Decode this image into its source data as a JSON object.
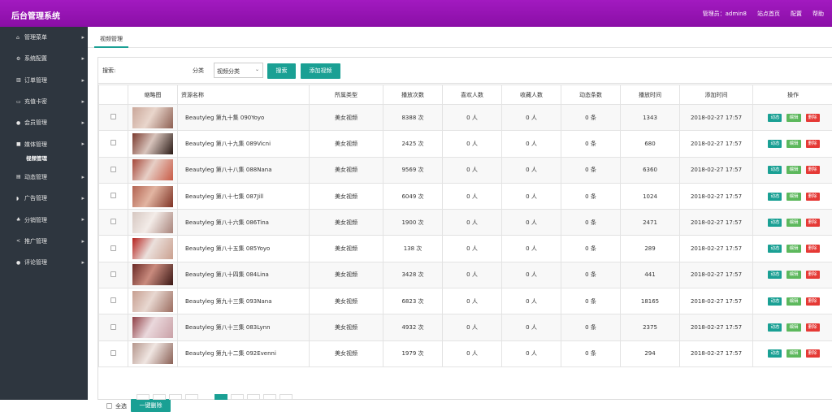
{
  "header": {
    "title": "后台管理系统",
    "admin_label": "管理员：admin8",
    "home_link": "站点首页",
    "config_link": "配置",
    "help_link": "帮助"
  },
  "sidebar": {
    "items": [
      {
        "label": "管理菜单",
        "icon": "home-icon",
        "glyph": "⌂"
      },
      {
        "label": "系统配置",
        "icon": "gears-icon",
        "glyph": "⚙"
      },
      {
        "label": "订单管理",
        "icon": "chart-icon",
        "glyph": "▥"
      },
      {
        "label": "充值卡密",
        "icon": "card-icon",
        "glyph": "▭"
      },
      {
        "label": "会员管理",
        "icon": "user-icon",
        "glyph": "●"
      },
      {
        "label": "媒体管理",
        "icon": "video-icon",
        "glyph": "■"
      },
      {
        "label": "动态管理",
        "icon": "folder-icon",
        "glyph": "▤"
      },
      {
        "label": "广告管理",
        "icon": "rss-icon",
        "glyph": "◗"
      },
      {
        "label": "分销管理",
        "icon": "sitemap-icon",
        "glyph": "♣"
      },
      {
        "label": "推广管理",
        "icon": "share-icon",
        "glyph": "<"
      },
      {
        "label": "评论管理",
        "icon": "comment-icon",
        "glyph": "●"
      }
    ],
    "sub_active": "视频管理",
    "arrow": "▸"
  },
  "tab": {
    "label": "视频管理"
  },
  "search": {
    "keyword_label": "搜索:",
    "keyword_value": "",
    "category_label": "分类",
    "category_value": "视频分类",
    "search_button": "搜索",
    "add_button": "添加视频"
  },
  "table": {
    "headers": [
      "",
      "缩略图",
      "资源名称",
      "所属类型",
      "播放次数",
      "喜欢人数",
      "收藏人数",
      "动态条数",
      "播放时间",
      "添加时间",
      "操作"
    ],
    "ops": {
      "dynamic": "动态",
      "edit": "编辑",
      "delete": "删除"
    },
    "rows": [
      {
        "name": "Beautyleg 第九十集 090Yoyo",
        "type": "美女视频",
        "plays": "8388 次",
        "likes": "0 人",
        "favs": "0 人",
        "posts": "0 条",
        "duration": "1343",
        "added": "2018-02-27 17:57"
      },
      {
        "name": "Beautyleg 第八十九集 089Vicni",
        "type": "美女视频",
        "plays": "2425 次",
        "likes": "0 人",
        "favs": "0 人",
        "posts": "0 条",
        "duration": "680",
        "added": "2018-02-27 17:57"
      },
      {
        "name": "Beautyleg 第八十八集 088Nana",
        "type": "美女视频",
        "plays": "9569 次",
        "likes": "0 人",
        "favs": "0 人",
        "posts": "0 条",
        "duration": "6360",
        "added": "2018-02-27 17:57"
      },
      {
        "name": "Beautyleg 第八十七集 087Jill",
        "type": "美女视频",
        "plays": "6049 次",
        "likes": "0 人",
        "favs": "0 人",
        "posts": "0 条",
        "duration": "1024",
        "added": "2018-02-27 17:57"
      },
      {
        "name": "Beautyleg 第八十六集 086Tina",
        "type": "美女视频",
        "plays": "1900 次",
        "likes": "0 人",
        "favs": "0 人",
        "posts": "0 条",
        "duration": "2471",
        "added": "2018-02-27 17:57"
      },
      {
        "name": "Beautyleg 第八十五集 085Yoyo",
        "type": "美女视频",
        "plays": "138 次",
        "likes": "0 人",
        "favs": "0 人",
        "posts": "0 条",
        "duration": "289",
        "added": "2018-02-27 17:57"
      },
      {
        "name": "Beautyleg 第八十四集 084Lina",
        "type": "美女视频",
        "plays": "3428 次",
        "likes": "0 人",
        "favs": "0 人",
        "posts": "0 条",
        "duration": "441",
        "added": "2018-02-27 17:57"
      },
      {
        "name": "Beautyleg 第九十三集 093Nana",
        "type": "美女视频",
        "plays": "6823 次",
        "likes": "0 人",
        "favs": "0 人",
        "posts": "0 条",
        "duration": "18165",
        "added": "2018-02-27 17:57"
      },
      {
        "name": "Beautyleg 第八十三集 083Lynn",
        "type": "美女视频",
        "plays": "4932 次",
        "likes": "0 人",
        "favs": "0 人",
        "posts": "0 条",
        "duration": "2375",
        "added": "2018-02-27 17:57"
      },
      {
        "name": "Beautyleg 第九十二集 092Evenni",
        "type": "美女视频",
        "plays": "1979 次",
        "likes": "0 人",
        "favs": "0 人",
        "posts": "0 条",
        "duration": "294",
        "added": "2018-02-27 17:57"
      }
    ]
  },
  "footer": {
    "select_all": "全选",
    "batch_delete": "一键删除"
  },
  "colors": {
    "header_purple": "#9414b3",
    "sidebar_dark": "#2e363f",
    "teal": "#1aa094",
    "edit_green": "#5cb85c",
    "delete_red": "#e53935"
  }
}
